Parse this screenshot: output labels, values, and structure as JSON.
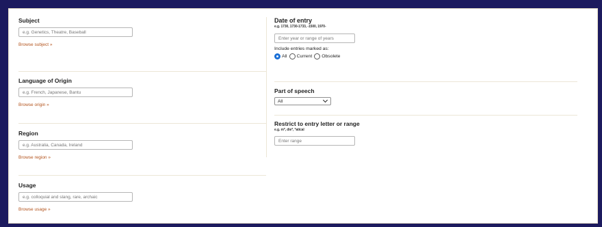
{
  "subject": {
    "label": "Subject",
    "placeholder": "e.g. Genetics, Theatre, Baseball",
    "browse": "Browse subject »"
  },
  "origin": {
    "label": "Language of Origin",
    "placeholder": "e.g. French, Japanese, Bantu",
    "browse": "Browse origin »"
  },
  "region": {
    "label": "Region",
    "placeholder": "e.g. Australia, Canada, Ireland",
    "browse": "Browse region »"
  },
  "usage": {
    "label": "Usage",
    "placeholder": "e.g. colloquial and slang, rare, archaic",
    "browse": "Browse usage »"
  },
  "date_of_entry": {
    "label": "Date of entry",
    "hint": "e.g. 1730, 1730-1733, -1500, 1970-",
    "placeholder": "Enter year or range of years",
    "include_label": "Include entries marked as:",
    "options": [
      "All",
      "Current",
      "Obsolete"
    ],
    "selected": "All"
  },
  "part_of_speech": {
    "label": "Part of speech",
    "selected": "All"
  },
  "restrict": {
    "label": "Restrict to entry letter or range",
    "hint": "e.g. m*, die*, *atical",
    "placeholder": "Enter range"
  },
  "colors": {
    "background": "#1c1a5e",
    "link": "#b3531c",
    "radio_checked": "#1a6fd6",
    "divider": "#ece6d6"
  }
}
